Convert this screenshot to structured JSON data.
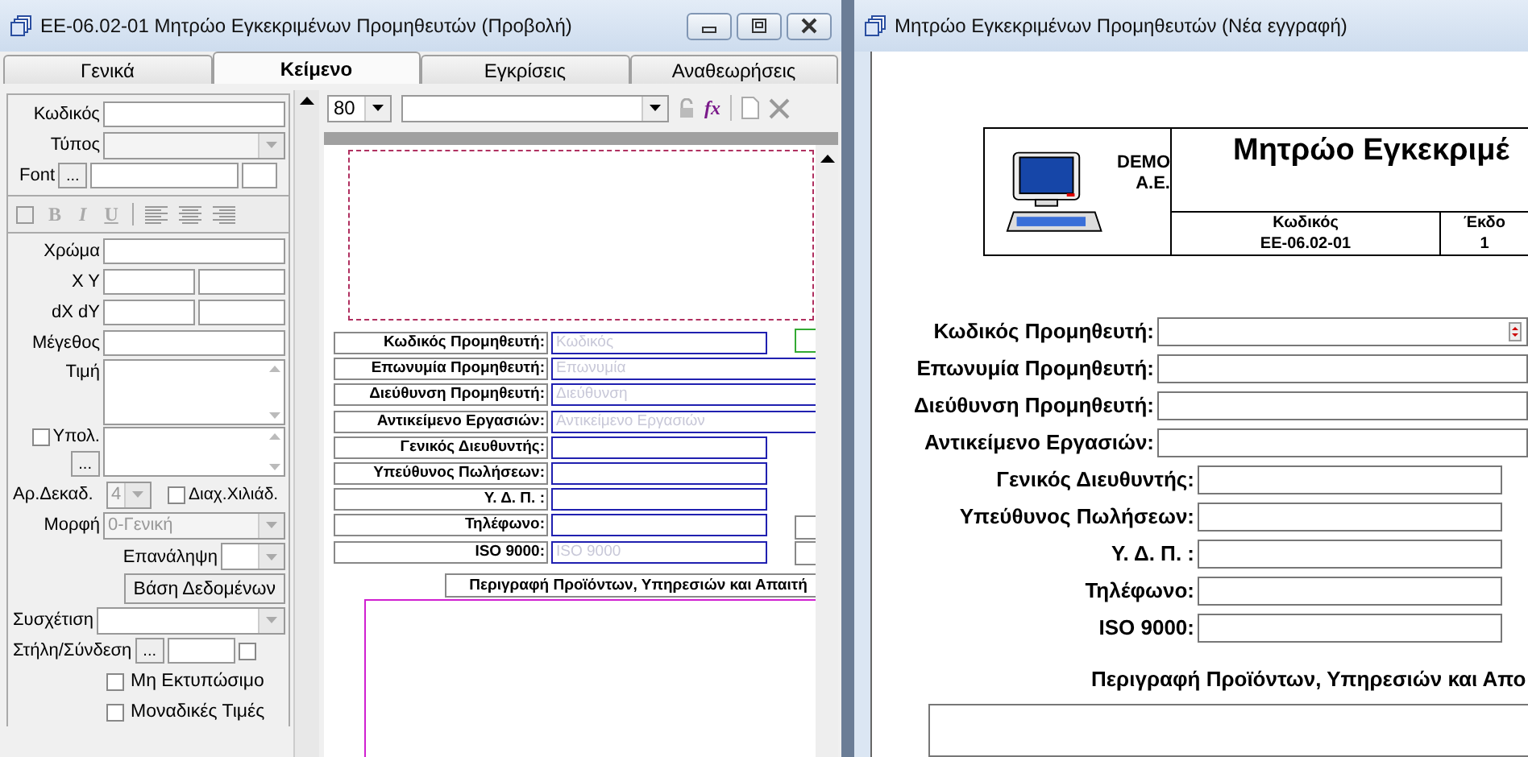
{
  "left_window": {
    "title": "EE-06.02-01 Μητρώο Εγκεκριμένων Προμηθευτών (Προβολή)",
    "tabs": [
      {
        "label": "Γενικά",
        "selected": false
      },
      {
        "label": "Κείμενο",
        "selected": true
      },
      {
        "label": "Εγκρίσεις",
        "selected": false
      },
      {
        "label": "Αναθεωρήσεις",
        "selected": false
      }
    ],
    "properties": {
      "code_label": "Κωδικός",
      "type_label": "Τύπος",
      "font_label": "Font",
      "font_button": "...",
      "style_buttons": [
        "B",
        "I",
        "U"
      ],
      "color_label": "Χρώμα",
      "xy_label": "X Y",
      "dxdy_label": "dX dY",
      "size_label": "Μέγεθος",
      "value_label": "Τιμή",
      "calc": {
        "label": "Υπολ.",
        "checked": false
      },
      "calc_button": "...",
      "decimals_label": "Αρ.Δεκαδ.",
      "decimals_value": "4",
      "thousands": {
        "label": "Διαχ.Χιλιάδ.",
        "checked": false
      },
      "format_label": "Μορφή",
      "format_value": "0-Γενική",
      "repeat_label": "Επανάληψη",
      "database_button": "Βάση Δεδομένων",
      "relation_label": "Συσχέτιση",
      "column_label": "Στήλη/Σύνδεση",
      "column_button": "...",
      "column_check": {
        "checked": false
      },
      "options": [
        {
          "label": "Μη Εκτυπώσιμο",
          "checked": false
        },
        {
          "label": "Μοναδικές Τιμές",
          "checked": false
        }
      ]
    },
    "toolbar": {
      "zoom": "80",
      "formula_button": "fx"
    },
    "design_fields": [
      {
        "label": "Κωδικός Προμηθευτή:",
        "placeholder": "Κωδικός",
        "kind": "short"
      },
      {
        "label": "Επωνυμία Προμηθευτή:",
        "placeholder": "Επωνυμία",
        "kind": "wide"
      },
      {
        "label": "Διεύθυνση Προμηθευτή:",
        "placeholder": "Διεύθυνση",
        "kind": "wide"
      },
      {
        "label": "Αντικείμενο Εργασιών:",
        "placeholder": "Αντικείμενο Εργασιών",
        "kind": "wide"
      },
      {
        "label": "Γενικός Διευθυντής:",
        "kind": "short"
      },
      {
        "label": "Υπεύθυνος Πωλήσεων:",
        "kind": "short"
      },
      {
        "label": "Υ. Δ. Π. :",
        "kind": "short"
      },
      {
        "label": "Τηλέφωνο:",
        "kind": "short"
      },
      {
        "label": "ISO 9000:",
        "placeholder": "ISO 9000",
        "kind": "short"
      }
    ],
    "section_label": "Περιγραφή Προϊόντων, Υπηρεσιών και Απαιτή"
  },
  "right_window": {
    "title": "Μητρώο Εγκεκριμένων Προμηθευτών (Νέα εγγραφή)",
    "company": [
      "DEMO",
      "A.E."
    ],
    "doc_title": "Μητρώο Εγκεκριμέ",
    "code_label": "Κωδικός",
    "code": "EE-06.02-01",
    "version_label": "Έκδο",
    "version": "1",
    "fields": [
      {
        "label": "Κωδικός Προμηθευτή:",
        "kind": "spinner"
      },
      {
        "label": "Επωνυμία Προμηθευτή:",
        "kind": "wide"
      },
      {
        "label": "Διεύθυνση Προμηθευτή:",
        "kind": "wide"
      },
      {
        "label": "Αντικείμενο Εργασιών:",
        "kind": "wide"
      },
      {
        "label": "Γενικός Διευθυντής:",
        "kind": "short"
      },
      {
        "label": "Υπεύθυνος Πωλήσεων:",
        "kind": "short"
      },
      {
        "label": "Υ. Δ. Π. :",
        "kind": "short"
      },
      {
        "label": "Τηλέφωνο:",
        "kind": "short"
      },
      {
        "label": "ISO 9000:",
        "kind": "short"
      }
    ],
    "section_title": "Περιγραφή Προϊόντων, Υπηρεσιών και Απο"
  }
}
